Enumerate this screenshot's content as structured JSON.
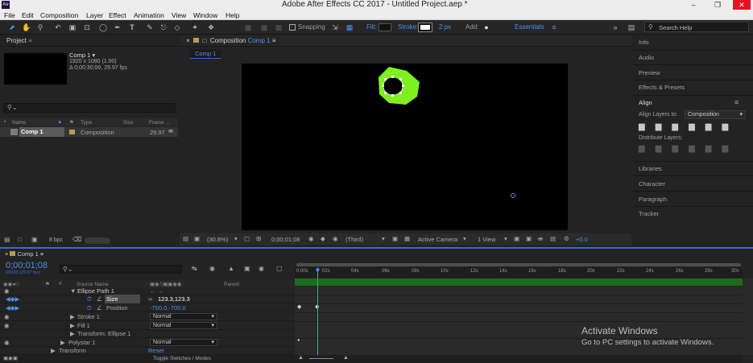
{
  "window": {
    "title": "Adobe After Effects CC 2017 - Untitled Project.aep *",
    "app_icon": "Ae"
  },
  "menu": [
    "File",
    "Edit",
    "Composition",
    "Layer",
    "Effect",
    "Animation",
    "View",
    "Window",
    "Help"
  ],
  "toolbar": {
    "snapping": "Snapping",
    "fill": "Fill:",
    "stroke": "Stroke:",
    "stroke_px": "2 px",
    "add": "Add:",
    "workspace": "Essentials",
    "search": "Search Help"
  },
  "project": {
    "title": "Project",
    "item_name": "Comp 1 ▾",
    "item_size": "1920 x 1080 (1.00)",
    "item_duration": "Δ 0;00;30;00, 29.97 fps",
    "cols": [
      "Name",
      "Type",
      "Size",
      "Frame ..."
    ],
    "row": {
      "name": "Comp 1",
      "type": "Composition",
      "fps": "29.97"
    },
    "bpc": "8 bpc"
  },
  "composition": {
    "tab": "Composition",
    "tab_name": "Comp 1",
    "breadcrumb": "Comp 1",
    "zoom": "(30.8%)",
    "timecode": "0;00;01;08",
    "resolution": "(Third)",
    "camera": "Active Camera",
    "views": "1 View",
    "exposure": "+0.0"
  },
  "right": {
    "items": [
      "Info",
      "Audio",
      "Preview",
      "Effects & Presets"
    ],
    "align": {
      "title": "Align",
      "to_label": "Align Layers to:",
      "to_value": "Composition",
      "distribute": "Distribute Layers:"
    },
    "more": [
      "Libraries",
      "Character",
      "Paragraph",
      "Tracker"
    ]
  },
  "timeline": {
    "comp": "Comp 1",
    "timecode": "0;00;01;08",
    "frames": "00038 (29.97 fps)",
    "cols": {
      "source": "Source Name",
      "parent": "Parent"
    },
    "rows": [
      {
        "label": "Ellipse Path 1",
        "indent": 96
      },
      {
        "label": "Size",
        "indent": 132,
        "value": "123.3,123.3"
      },
      {
        "label": "Position",
        "indent": 132,
        "value": "-700.0,-700.0"
      },
      {
        "label": "Stroke 1",
        "indent": 96,
        "mode": "Normal"
      },
      {
        "label": "Fill 1",
        "indent": 96,
        "mode": "Normal"
      },
      {
        "label": "Transform: Ellipse 1",
        "indent": 96,
        "mode": ""
      },
      {
        "label": "Polystar 1",
        "indent": 84,
        "mode": "Normal"
      },
      {
        "label": "Transform",
        "indent": 73,
        "value": "Reset"
      }
    ],
    "ticks": [
      "0:00s",
      "02s",
      "04s",
      "06s",
      "08s",
      "10s",
      "12s",
      "14s",
      "16s",
      "18s",
      "20s",
      "22s",
      "24s",
      "26s",
      "28s",
      "30s"
    ],
    "toggle": "Toggle Switches / Modes"
  },
  "watermark": {
    "title": "Activate Windows",
    "subtitle": "Go to PC settings to activate Windows."
  },
  "colors": {
    "accent": "#2d6fd8",
    "shape": "#7ef01e"
  }
}
